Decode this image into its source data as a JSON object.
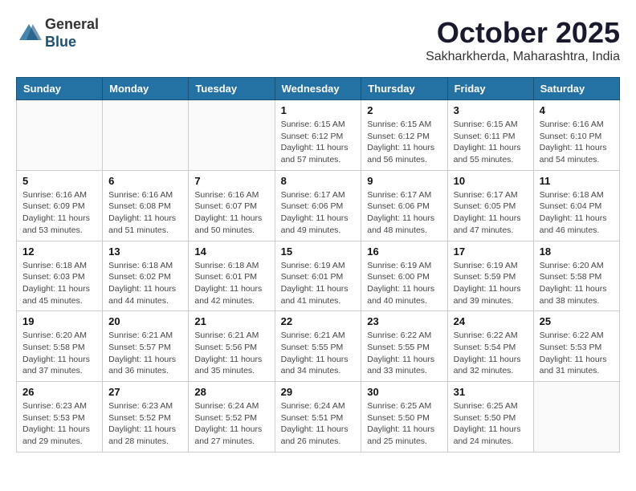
{
  "header": {
    "logo_line1": "General",
    "logo_line2": "Blue",
    "month": "October 2025",
    "location": "Sakharkherda, Maharashtra, India"
  },
  "weekdays": [
    "Sunday",
    "Monday",
    "Tuesday",
    "Wednesday",
    "Thursday",
    "Friday",
    "Saturday"
  ],
  "weeks": [
    [
      {
        "day": "",
        "info": ""
      },
      {
        "day": "",
        "info": ""
      },
      {
        "day": "",
        "info": ""
      },
      {
        "day": "1",
        "info": "Sunrise: 6:15 AM\nSunset: 6:12 PM\nDaylight: 11 hours\nand 57 minutes."
      },
      {
        "day": "2",
        "info": "Sunrise: 6:15 AM\nSunset: 6:12 PM\nDaylight: 11 hours\nand 56 minutes."
      },
      {
        "day": "3",
        "info": "Sunrise: 6:15 AM\nSunset: 6:11 PM\nDaylight: 11 hours\nand 55 minutes."
      },
      {
        "day": "4",
        "info": "Sunrise: 6:16 AM\nSunset: 6:10 PM\nDaylight: 11 hours\nand 54 minutes."
      }
    ],
    [
      {
        "day": "5",
        "info": "Sunrise: 6:16 AM\nSunset: 6:09 PM\nDaylight: 11 hours\nand 53 minutes."
      },
      {
        "day": "6",
        "info": "Sunrise: 6:16 AM\nSunset: 6:08 PM\nDaylight: 11 hours\nand 51 minutes."
      },
      {
        "day": "7",
        "info": "Sunrise: 6:16 AM\nSunset: 6:07 PM\nDaylight: 11 hours\nand 50 minutes."
      },
      {
        "day": "8",
        "info": "Sunrise: 6:17 AM\nSunset: 6:06 PM\nDaylight: 11 hours\nand 49 minutes."
      },
      {
        "day": "9",
        "info": "Sunrise: 6:17 AM\nSunset: 6:06 PM\nDaylight: 11 hours\nand 48 minutes."
      },
      {
        "day": "10",
        "info": "Sunrise: 6:17 AM\nSunset: 6:05 PM\nDaylight: 11 hours\nand 47 minutes."
      },
      {
        "day": "11",
        "info": "Sunrise: 6:18 AM\nSunset: 6:04 PM\nDaylight: 11 hours\nand 46 minutes."
      }
    ],
    [
      {
        "day": "12",
        "info": "Sunrise: 6:18 AM\nSunset: 6:03 PM\nDaylight: 11 hours\nand 45 minutes."
      },
      {
        "day": "13",
        "info": "Sunrise: 6:18 AM\nSunset: 6:02 PM\nDaylight: 11 hours\nand 44 minutes."
      },
      {
        "day": "14",
        "info": "Sunrise: 6:18 AM\nSunset: 6:01 PM\nDaylight: 11 hours\nand 42 minutes."
      },
      {
        "day": "15",
        "info": "Sunrise: 6:19 AM\nSunset: 6:01 PM\nDaylight: 11 hours\nand 41 minutes."
      },
      {
        "day": "16",
        "info": "Sunrise: 6:19 AM\nSunset: 6:00 PM\nDaylight: 11 hours\nand 40 minutes."
      },
      {
        "day": "17",
        "info": "Sunrise: 6:19 AM\nSunset: 5:59 PM\nDaylight: 11 hours\nand 39 minutes."
      },
      {
        "day": "18",
        "info": "Sunrise: 6:20 AM\nSunset: 5:58 PM\nDaylight: 11 hours\nand 38 minutes."
      }
    ],
    [
      {
        "day": "19",
        "info": "Sunrise: 6:20 AM\nSunset: 5:58 PM\nDaylight: 11 hours\nand 37 minutes."
      },
      {
        "day": "20",
        "info": "Sunrise: 6:21 AM\nSunset: 5:57 PM\nDaylight: 11 hours\nand 36 minutes."
      },
      {
        "day": "21",
        "info": "Sunrise: 6:21 AM\nSunset: 5:56 PM\nDaylight: 11 hours\nand 35 minutes."
      },
      {
        "day": "22",
        "info": "Sunrise: 6:21 AM\nSunset: 5:55 PM\nDaylight: 11 hours\nand 34 minutes."
      },
      {
        "day": "23",
        "info": "Sunrise: 6:22 AM\nSunset: 5:55 PM\nDaylight: 11 hours\nand 33 minutes."
      },
      {
        "day": "24",
        "info": "Sunrise: 6:22 AM\nSunset: 5:54 PM\nDaylight: 11 hours\nand 32 minutes."
      },
      {
        "day": "25",
        "info": "Sunrise: 6:22 AM\nSunset: 5:53 PM\nDaylight: 11 hours\nand 31 minutes."
      }
    ],
    [
      {
        "day": "26",
        "info": "Sunrise: 6:23 AM\nSunset: 5:53 PM\nDaylight: 11 hours\nand 29 minutes."
      },
      {
        "day": "27",
        "info": "Sunrise: 6:23 AM\nSunset: 5:52 PM\nDaylight: 11 hours\nand 28 minutes."
      },
      {
        "day": "28",
        "info": "Sunrise: 6:24 AM\nSunset: 5:52 PM\nDaylight: 11 hours\nand 27 minutes."
      },
      {
        "day": "29",
        "info": "Sunrise: 6:24 AM\nSunset: 5:51 PM\nDaylight: 11 hours\nand 26 minutes."
      },
      {
        "day": "30",
        "info": "Sunrise: 6:25 AM\nSunset: 5:50 PM\nDaylight: 11 hours\nand 25 minutes."
      },
      {
        "day": "31",
        "info": "Sunrise: 6:25 AM\nSunset: 5:50 PM\nDaylight: 11 hours\nand 24 minutes."
      },
      {
        "day": "",
        "info": ""
      }
    ]
  ]
}
